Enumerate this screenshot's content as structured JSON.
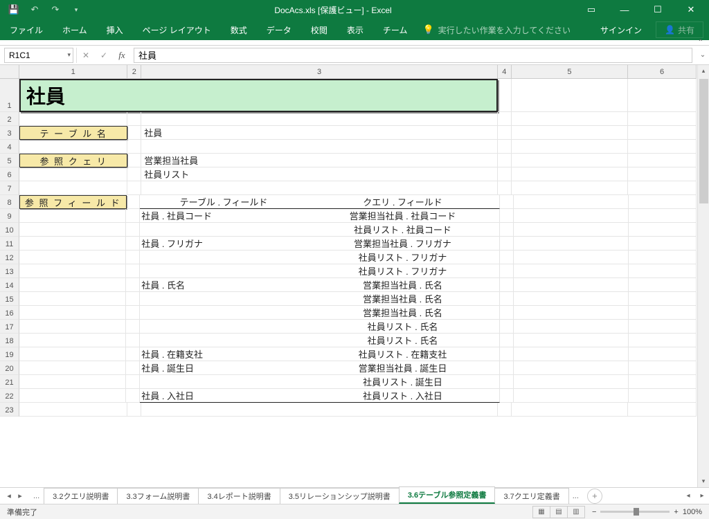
{
  "title": "DocAcs.xls [保護ビュー] - Excel",
  "qat": {
    "save": "save",
    "undo": "undo",
    "redo": "redo"
  },
  "window": {
    "ribbonopts": "ribbon-options",
    "min": "minimize",
    "max": "maximize",
    "close": "close"
  },
  "ribbon": {
    "tabs": [
      "ファイル",
      "ホーム",
      "挿入",
      "ページ レイアウト",
      "数式",
      "データ",
      "校閲",
      "表示",
      "チーム"
    ],
    "tellme": "実行したい作業を入力してください",
    "signin": "サインイン",
    "share": "共有"
  },
  "namebox": "R1C1",
  "formula": "社員",
  "colHeaders": [
    "1",
    "2",
    "3",
    "4",
    "5",
    "6"
  ],
  "rowHeaders": [
    "1",
    "2",
    "3",
    "4",
    "5",
    "6",
    "7",
    "8",
    "9",
    "10",
    "11",
    "12",
    "13",
    "14",
    "15",
    "16",
    "17",
    "18",
    "19",
    "20",
    "21",
    "22",
    "23"
  ],
  "sheet": {
    "title": "社員",
    "labels": {
      "tableName": "テ ー ブ ル 名",
      "refQuery": "参 照 ク ェ リ",
      "refField": "参 照 フ ィ ー ル ド"
    },
    "tableName": "社員",
    "refQueries": [
      "営業担当社員",
      "社員リスト"
    ],
    "fieldHead": {
      "left": "テーブル . フィールド",
      "right": "クエリ . フィールド"
    },
    "fields": [
      {
        "t": "社員 . 社員コード",
        "q": "営業担当社員 . 社員コード"
      },
      {
        "t": "",
        "q": "社員リスト . 社員コード"
      },
      {
        "t": "社員 . フリガナ",
        "q": "営業担当社員 . フリガナ"
      },
      {
        "t": "",
        "q": "社員リスト . フリガナ"
      },
      {
        "t": "",
        "q": "社員リスト . フリガナ"
      },
      {
        "t": "社員 . 氏名",
        "q": "営業担当社員 . 氏名"
      },
      {
        "t": "",
        "q": "営業担当社員 . 氏名"
      },
      {
        "t": "",
        "q": "営業担当社員 . 氏名"
      },
      {
        "t": "",
        "q": "社員リスト . 氏名"
      },
      {
        "t": "",
        "q": "社員リスト . 氏名"
      },
      {
        "t": "社員 . 在籍支社",
        "q": "社員リスト . 在籍支社"
      },
      {
        "t": "社員 . 誕生日",
        "q": "営業担当社員 . 誕生日"
      },
      {
        "t": "",
        "q": "社員リスト . 誕生日"
      },
      {
        "t": "社員 . 入社日",
        "q": "社員リスト . 入社日"
      }
    ]
  },
  "tabs": {
    "ellipsis": "...",
    "items": [
      "3.2クエリ説明書",
      "3.3フォーム説明書",
      "3.4レポート説明書",
      "3.5リレーションシップ説明書",
      "3.6テーブル参照定義書",
      "3.7クエリ定義書"
    ],
    "active": 4,
    "more": "..."
  },
  "status": {
    "ready": "準備完了",
    "zoom": "100%"
  }
}
